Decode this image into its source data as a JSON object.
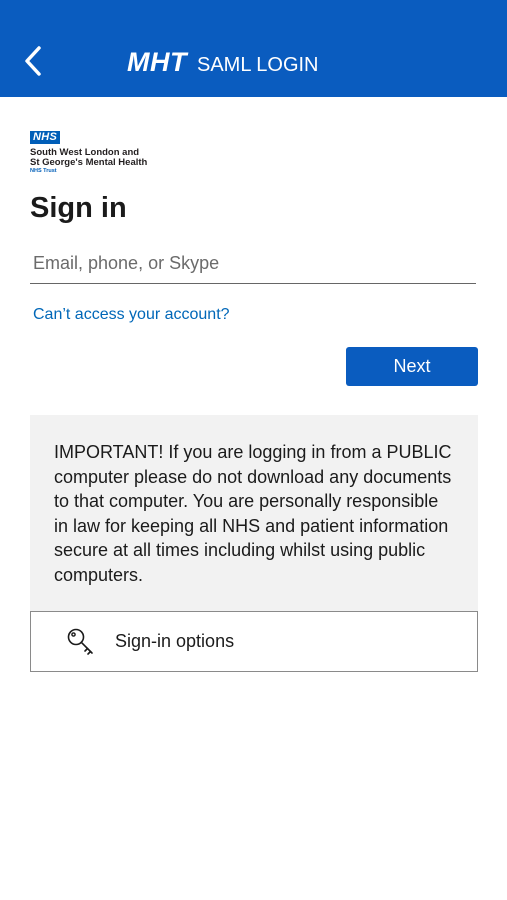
{
  "header": {
    "brand": "MHT",
    "subtitle": "SAML LOGIN",
    "back_icon": "chevron-left-icon",
    "background": "#0a5cbf"
  },
  "logo": {
    "badge": "NHS",
    "line1": "South West London and",
    "line2": "St George's Mental Health",
    "line3": "NHS Trust"
  },
  "signin": {
    "title": "Sign in",
    "email_placeholder": "Email, phone, or Skype",
    "email_value": "",
    "cant_access_link": "Can’t access your account?",
    "next_label": "Next"
  },
  "notice": {
    "text": "IMPORTANT! If you are logging in from a PUBLIC computer please do not download any documents to that computer. You are personally responsible in law for keeping all NHS and patient information secure at all times including whilst using public computers."
  },
  "signin_options": {
    "label": "Sign-in options",
    "icon": "key-icon"
  },
  "colors": {
    "accent": "#0a5cbf",
    "link": "#0067b8",
    "notice_bg": "#f2f2f2"
  }
}
